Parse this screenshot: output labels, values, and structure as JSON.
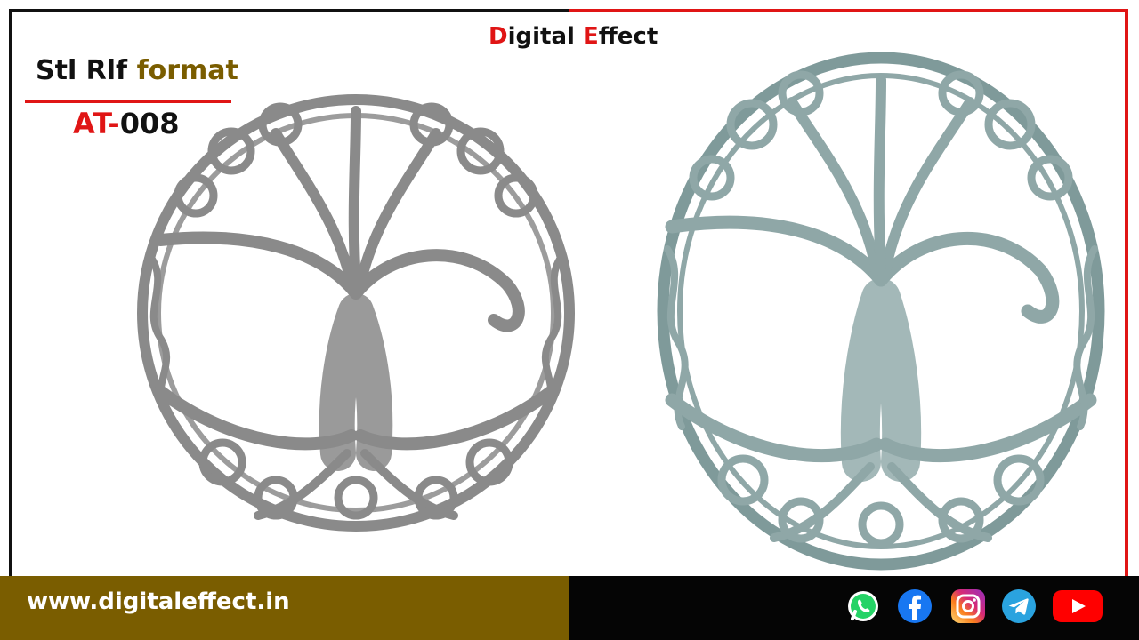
{
  "brand": {
    "first_letter": "D",
    "word1_rest": "igital ",
    "second_letter": "E",
    "word2_rest": "ffect"
  },
  "format": {
    "prefix": "Stl Rlf ",
    "highlight": "format"
  },
  "code": {
    "prefix": "AT-",
    "number": "008"
  },
  "footer": {
    "website": "www.digitaleffect.in"
  },
  "social_icons": [
    "whatsapp-icon",
    "facebook-icon",
    "instagram-icon",
    "telegram-icon",
    "youtube-icon"
  ],
  "colors": {
    "accent_red": "#e01515",
    "gold": "#7a5d00",
    "black": "#050505",
    "relief_gray": "#8a8a8a",
    "relief_teal": "#8fa7a7"
  }
}
